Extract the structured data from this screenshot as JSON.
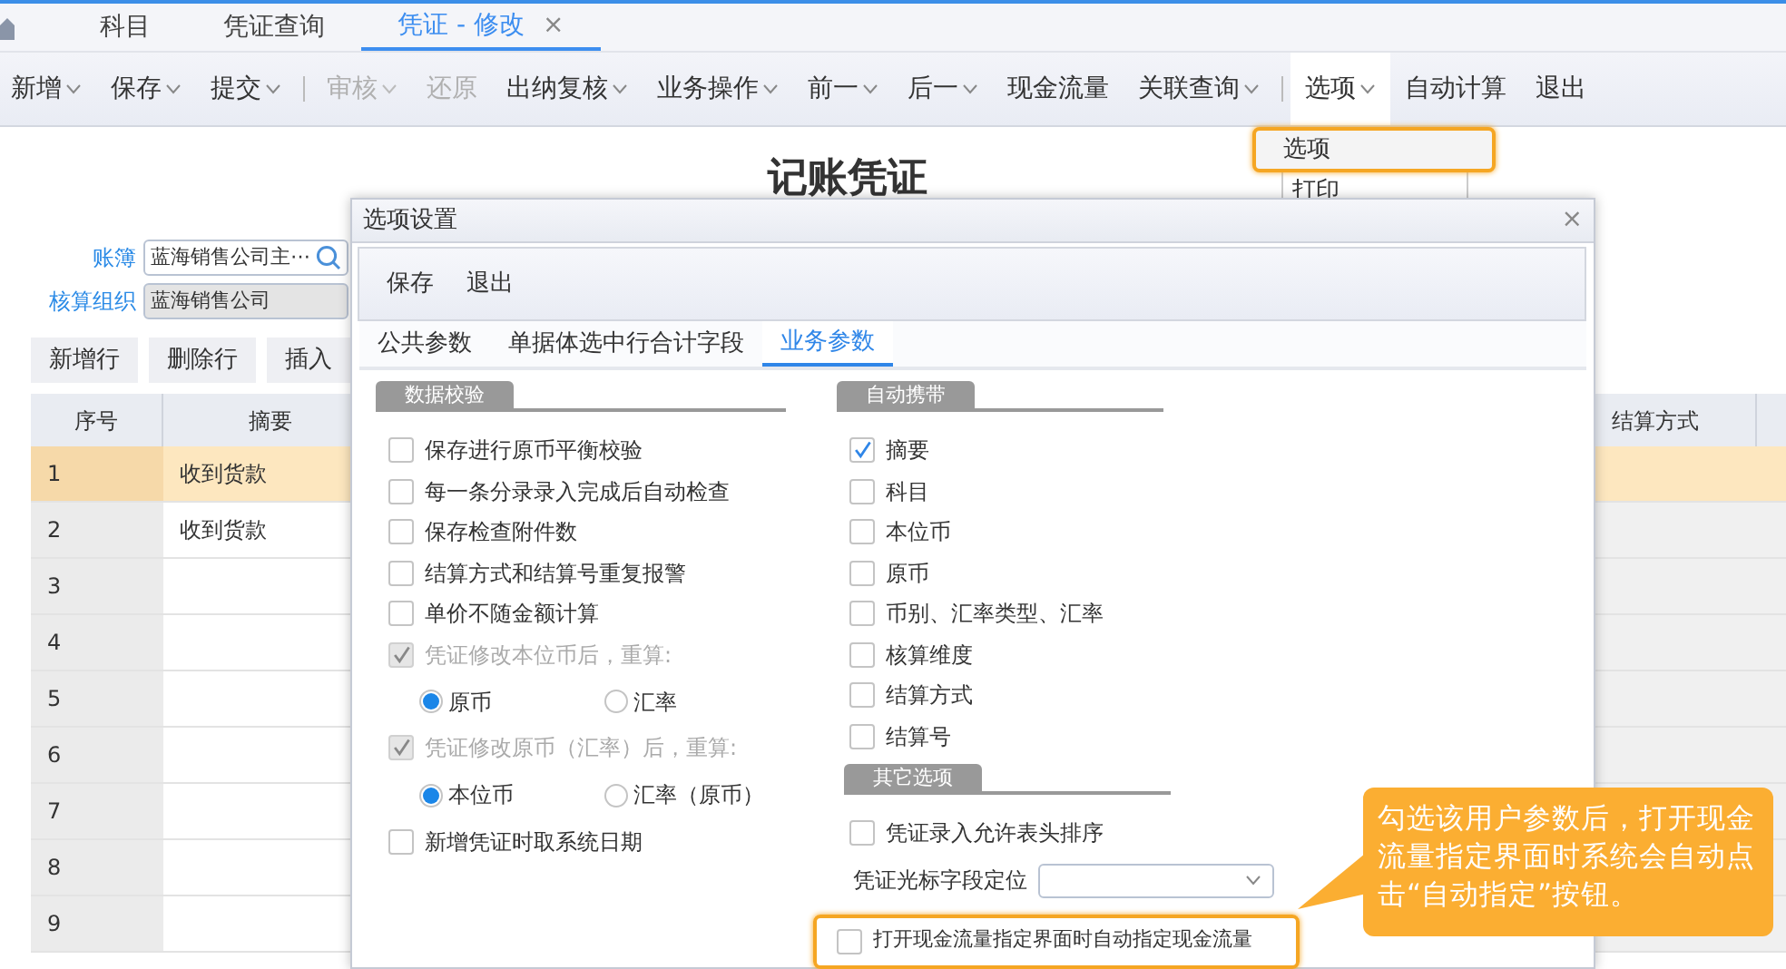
{
  "tabs": [
    {
      "label": "科目",
      "selected": false
    },
    {
      "label": "凭证查询",
      "selected": false
    },
    {
      "label": "凭证 - 修改",
      "selected": true,
      "close": "×"
    }
  ],
  "toolbar": [
    {
      "label": "新增",
      "caret": true,
      "disabled": false,
      "open": false
    },
    {
      "label": "保存",
      "caret": true,
      "disabled": false,
      "open": false
    },
    {
      "label": "提交",
      "caret": true,
      "disabled": false,
      "open": false,
      "separator_after": true
    },
    {
      "label": "审核",
      "caret": true,
      "disabled": true,
      "open": false
    },
    {
      "label": "还原",
      "caret": false,
      "disabled": true,
      "open": false
    },
    {
      "label": "出纳复核",
      "caret": true,
      "disabled": false,
      "open": false
    },
    {
      "label": "业务操作",
      "caret": true,
      "disabled": false,
      "open": false
    },
    {
      "label": "前一",
      "caret": true,
      "disabled": false,
      "open": false
    },
    {
      "label": "后一",
      "caret": true,
      "disabled": false,
      "open": false
    },
    {
      "label": "现金流量",
      "caret": false,
      "disabled": false,
      "open": false
    },
    {
      "label": "关联查询",
      "caret": true,
      "disabled": false,
      "open": false,
      "separator_after": true
    },
    {
      "label": "选项",
      "caret": true,
      "disabled": false,
      "open": true
    },
    {
      "label": "自动计算",
      "caret": false,
      "disabled": false,
      "open": false
    },
    {
      "label": "退出",
      "caret": false,
      "disabled": false,
      "open": false
    }
  ],
  "menu": {
    "items": [
      {
        "label": "选项",
        "highlighted": true
      },
      {
        "label": "打印",
        "highlighted": false
      }
    ]
  },
  "page": {
    "title": "记账凭证",
    "fields": [
      {
        "label": "账簿",
        "value": "蓝海销售公司主⋯",
        "kind": "lookup"
      },
      {
        "label": "核算组织",
        "value": "蓝海销售公司",
        "kind": "readonly"
      }
    ]
  },
  "grid_buttons": [
    "新增行",
    "删除行",
    "插入"
  ],
  "grid": {
    "columns": [
      "序号",
      "摘要",
      "结算方式"
    ],
    "rows": [
      {
        "no": "1",
        "summary": "收到货款",
        "selected": true
      },
      {
        "no": "2",
        "summary": "收到货款",
        "selected": false
      },
      {
        "no": "3",
        "selected": false
      },
      {
        "no": "4",
        "selected": false
      },
      {
        "no": "5",
        "selected": false
      },
      {
        "no": "6",
        "selected": false
      },
      {
        "no": "7",
        "selected": false
      },
      {
        "no": "8",
        "selected": false
      },
      {
        "no": "9",
        "selected": false
      }
    ]
  },
  "dialog": {
    "title": "选项设置",
    "close": "×",
    "actions": [
      "保存",
      "退出"
    ],
    "tabs": [
      {
        "label": "公共参数",
        "selected": false
      },
      {
        "label": "单据体选中行合计字段",
        "selected": false
      },
      {
        "label": "业务参数",
        "selected": true
      }
    ],
    "columns": [
      {
        "sections": [
          {
            "title": "数据校验",
            "items": [
              {
                "kind": "checkbox",
                "label": "保存进行原币平衡校验",
                "checked": false,
                "disabled": false
              },
              {
                "kind": "checkbox",
                "label": "每一条分录录入完成后自动检查",
                "checked": false,
                "disabled": false
              },
              {
                "kind": "checkbox",
                "label": "保存检查附件数",
                "checked": false,
                "disabled": false
              },
              {
                "kind": "checkbox",
                "label": "结算方式和结算号重复报警",
                "checked": false,
                "disabled": false
              },
              {
                "kind": "checkbox",
                "label": "单价不随金额计算",
                "checked": false,
                "disabled": false
              },
              {
                "kind": "checkbox",
                "label": "凭证修改本位币后，重算:",
                "checked": true,
                "disabled": true
              },
              {
                "kind": "radios",
                "options": [
                  {
                    "label": "原币",
                    "selected": true
                  },
                  {
                    "label": "汇率",
                    "selected": false
                  }
                ]
              },
              {
                "kind": "checkbox",
                "label": "凭证修改原币（汇率）后，重算:",
                "checked": true,
                "disabled": true
              },
              {
                "kind": "radios",
                "options": [
                  {
                    "label": "本位币",
                    "selected": true
                  },
                  {
                    "label": "汇率（原币）",
                    "selected": false
                  }
                ]
              },
              {
                "kind": "checkbox",
                "label": "新增凭证时取系统日期",
                "checked": false,
                "disabled": false
              }
            ]
          }
        ]
      },
      {
        "sections": [
          {
            "title": "自动携带",
            "items": [
              {
                "kind": "checkbox",
                "label": "摘要",
                "checked": true,
                "disabled": false
              },
              {
                "kind": "checkbox",
                "label": "科目",
                "checked": false,
                "disabled": false
              },
              {
                "kind": "checkbox",
                "label": "本位币",
                "checked": false,
                "disabled": false
              },
              {
                "kind": "checkbox",
                "label": "原币",
                "checked": false,
                "disabled": false
              },
              {
                "kind": "checkbox",
                "label": "币别、汇率类型、汇率",
                "checked": false,
                "disabled": false
              },
              {
                "kind": "checkbox",
                "label": "核算维度",
                "checked": false,
                "disabled": false
              },
              {
                "kind": "checkbox",
                "label": "结算方式",
                "checked": false,
                "disabled": false
              },
              {
                "kind": "checkbox",
                "label": "结算号",
                "checked": false,
                "disabled": false
              }
            ]
          },
          {
            "title": "其它选项",
            "items": [
              {
                "kind": "checkbox",
                "label": "凭证录入允许表头排序",
                "checked": false,
                "disabled": false
              },
              {
                "kind": "select",
                "label": "凭证光标字段定位"
              },
              {
                "kind": "checkbox",
                "label": "打开现金流量指定界面时自动指定现金流量",
                "checked": false,
                "disabled": false,
                "highlighted": true
              }
            ]
          }
        ]
      }
    ]
  },
  "callout": {
    "text": "勾选该用户参数后，打开现金流量指定界面时系统会自动点击“自动指定”按钮。"
  }
}
